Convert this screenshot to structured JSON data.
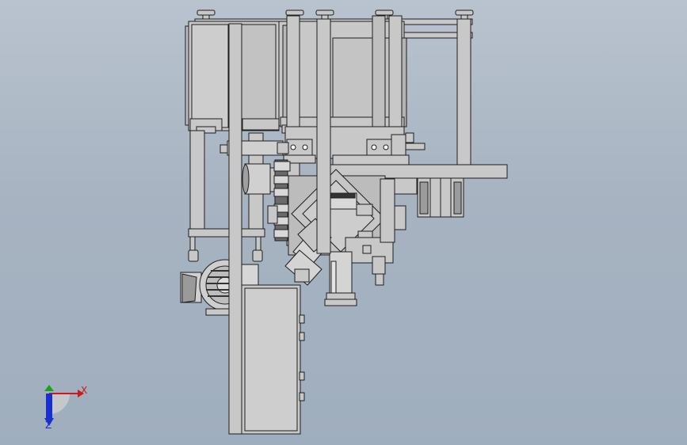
{
  "viewport": {
    "background_top": "#b9c3cf",
    "background_bottom": "#9faebe",
    "part_fill": "#c8c8c8",
    "part_stroke": "#1e1e1e",
    "part_shadow": "#9d9d9d"
  },
  "triad": {
    "x_label": "X",
    "z_label": "Z",
    "x_color": "#d01818",
    "y_color": "#1aa31a",
    "z_color": "#1a2fd0"
  }
}
